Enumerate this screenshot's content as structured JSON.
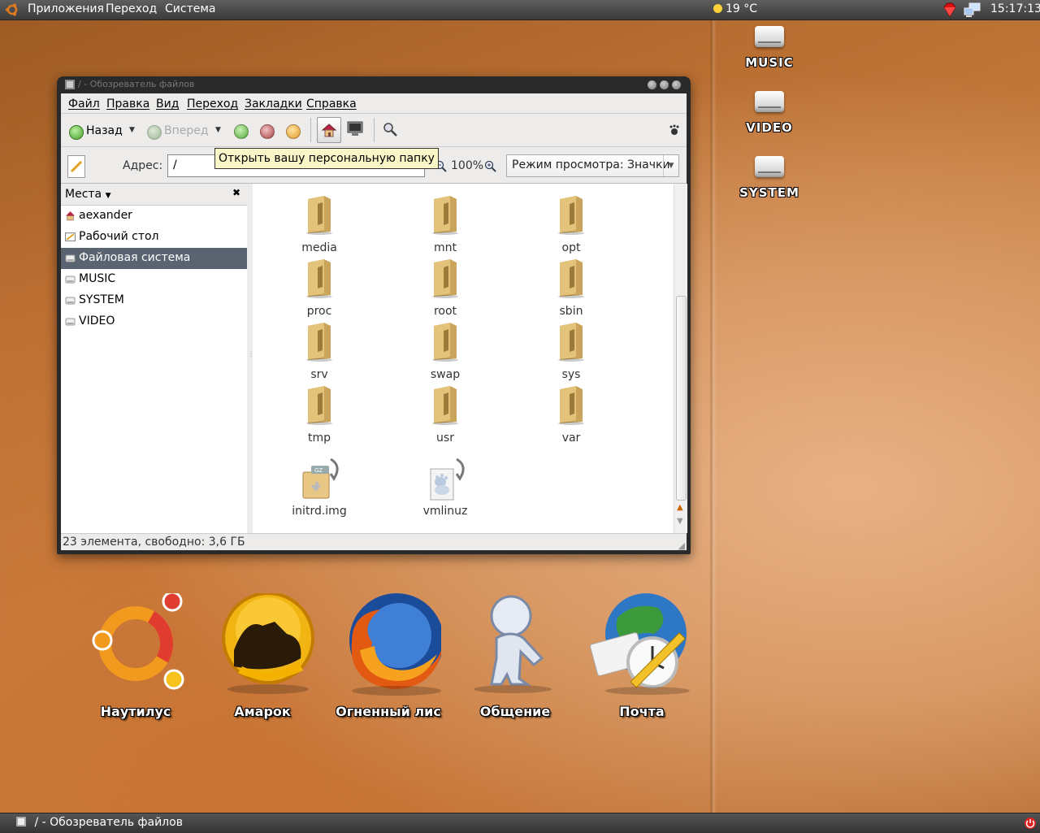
{
  "top_panel": {
    "menus": [
      "Приложения",
      "Переход",
      "Система"
    ],
    "weather": "19 °C",
    "clock": "15:17:13"
  },
  "desktop_drives": [
    "MUSIC",
    "VIDEO",
    "SYSTEM"
  ],
  "window": {
    "title": "/ - Обозреватель файлов",
    "menu": [
      "Файл",
      "Правка",
      "Вид",
      "Переход",
      "Закладки",
      "Справка"
    ],
    "toolbar": {
      "back": "Назад",
      "forward": "Вперед"
    },
    "tooltip": "Открыть вашу персональную папку",
    "location": {
      "label": "Адрес:",
      "value": "/",
      "zoom": "100%",
      "view_mode": "Режим просмотра: Значки"
    },
    "sidebar": {
      "header": "Места",
      "items": [
        "aexander",
        "Рабочий стол",
        "Файловая система",
        "MUSIC",
        "SYSTEM",
        "VIDEO"
      ],
      "selected": "Файловая система"
    },
    "files": [
      "media",
      "mnt",
      "opt",
      "proc",
      "root",
      "sbin",
      "srv",
      "swap",
      "sys",
      "tmp",
      "usr",
      "var",
      "initrd.img",
      "vmlinuz"
    ],
    "status": "23 элемента, свободно: 3,6 ГБ"
  },
  "dock": [
    "Наутилус",
    "Амарок",
    "Огненный лис",
    "Общение",
    "Почта"
  ],
  "taskbar": {
    "window": "/ - Обозреватель файлов"
  },
  "colors": {
    "selection": "#5a6470",
    "tooltip": "#fbf6c8",
    "folder": "#c9a45a"
  }
}
